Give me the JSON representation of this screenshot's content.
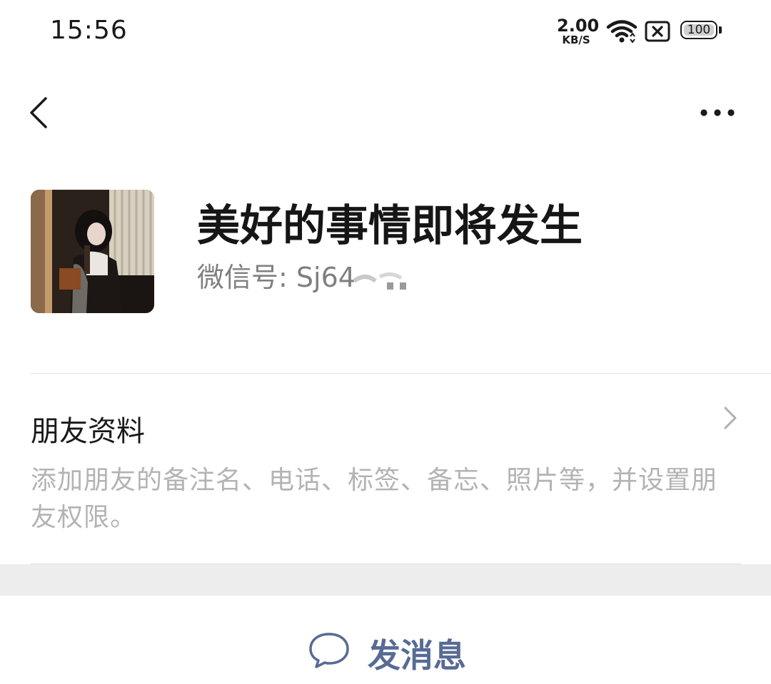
{
  "status_bar": {
    "time": "15:56",
    "net_speed_value": "2.00",
    "net_speed_unit": "KB/S",
    "battery_level": "100",
    "icons": [
      "wifi-icon",
      "sim-no-signal-icon",
      "battery-icon"
    ]
  },
  "nav": {
    "back_icon": "chevron-left-icon",
    "more_icon": "more-dots-icon"
  },
  "profile": {
    "nickname": "美好的事情即将发生",
    "wechat_id_label": "微信号:",
    "wechat_id_value": "Sj64",
    "avatar": "avatar-photo"
  },
  "friend_info": {
    "title": "朋友资料",
    "description": "添加朋友的备注名、电话、标签、备忘、照片等，并设置朋友权限。"
  },
  "actions": {
    "send_message_label": "发消息",
    "send_message_icon": "chat-bubble-icon"
  },
  "colors": {
    "link_blue": "#576b95",
    "hint_gray": "#b3b3b3",
    "band_gray": "#ededed"
  }
}
